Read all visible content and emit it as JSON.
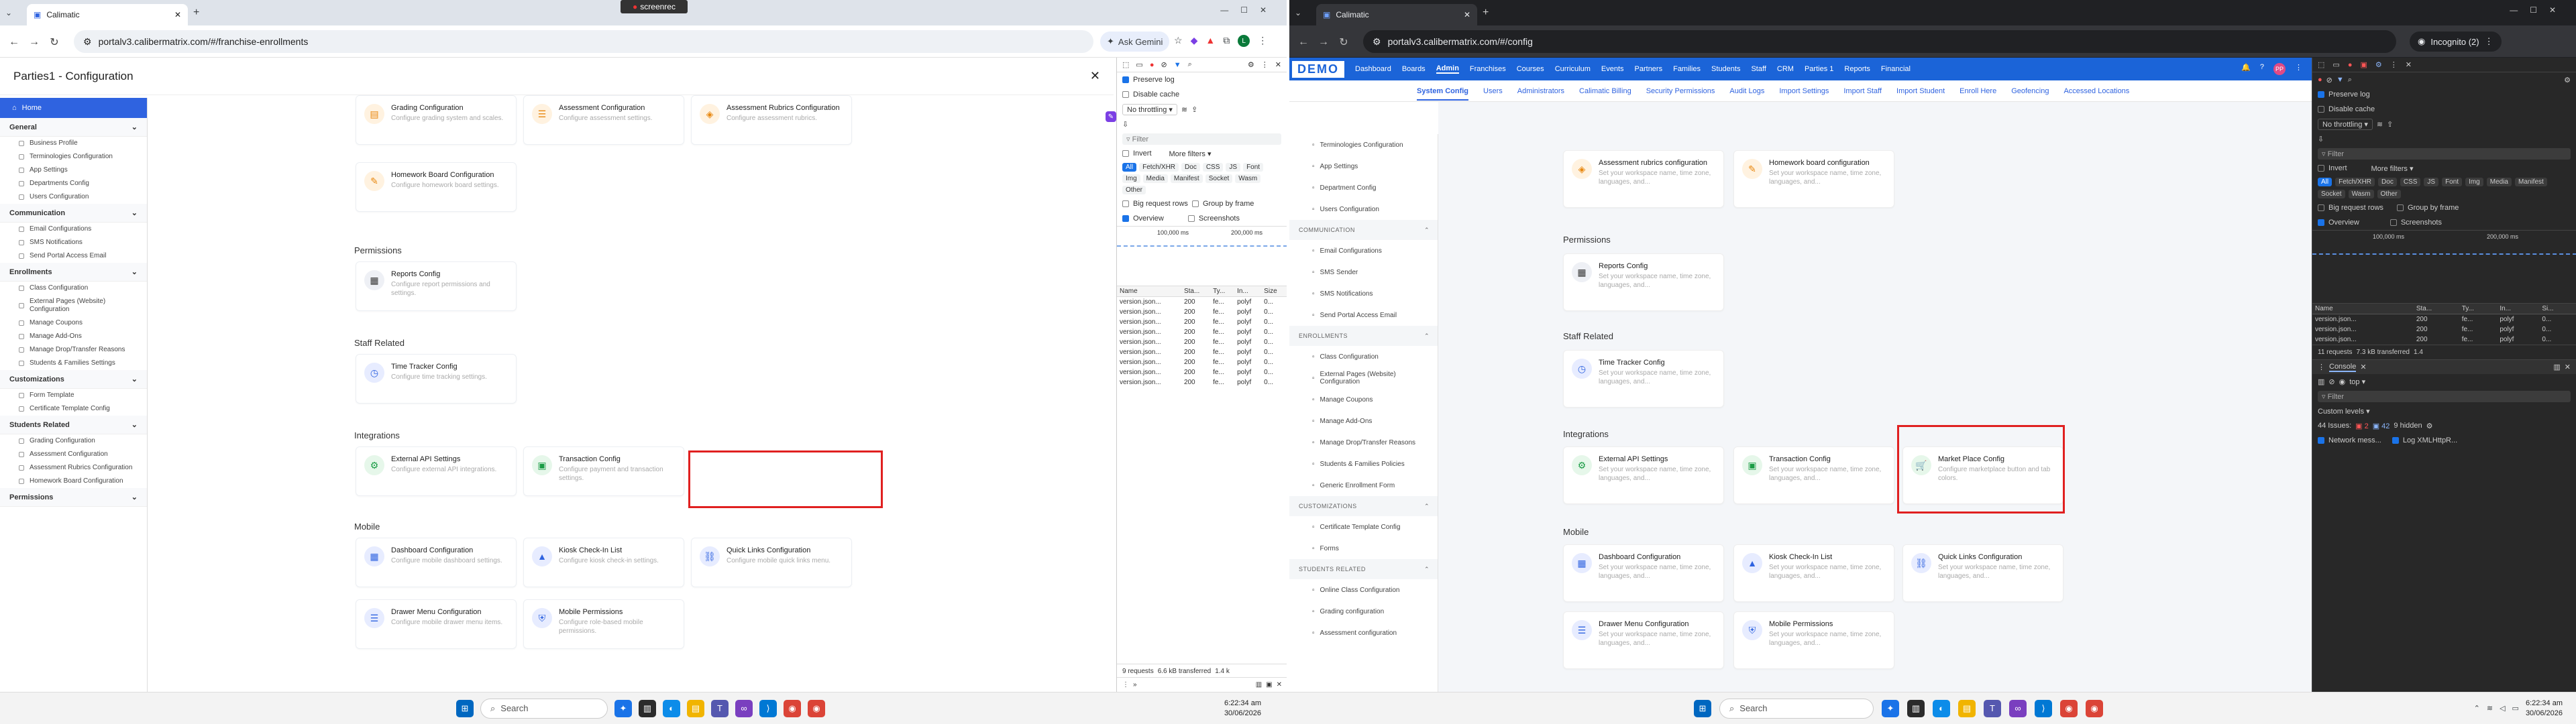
{
  "recorder": {
    "label": "screenrec"
  },
  "left": {
    "tab_title": "Calimatic",
    "url": "portalv3.calibermatrix.com/#/franchise-enrollments",
    "ask_gemini": "Ask Gemini",
    "modal_title": "Parties1 - Configuration",
    "sidebar": {
      "home": "Home",
      "sections": [
        {
          "title": "General",
          "items": [
            "Business Profile",
            "Terminologies Configuration",
            "App Settings",
            "Departments Config",
            "Users Configuration"
          ]
        },
        {
          "title": "Communication",
          "items": [
            "Email Configurations",
            "SMS Notifications",
            "Send Portal Access Email"
          ]
        },
        {
          "title": "Enrollments",
          "items": [
            "Class Configuration",
            "External Pages (Website) Configuration",
            "Manage Coupons",
            "Manage Add-Ons",
            "Manage Drop/Transfer Reasons",
            "Students & Families Settings"
          ]
        },
        {
          "title": "Customizations",
          "items": [
            "Form Template",
            "Certificate Template Config"
          ]
        },
        {
          "title": "Students Related",
          "items": [
            "Grading Configuration",
            "Assessment Configuration",
            "Assessment Rubrics Configuration",
            "Homework Board Configuration"
          ]
        },
        {
          "title": "Permissions",
          "items": []
        }
      ]
    },
    "cards_top": [
      {
        "title": "Grading Configuration",
        "desc": "Configure grading system and scales."
      },
      {
        "title": "Assessment Configuration",
        "desc": "Configure assessment settings."
      },
      {
        "title": "Assessment Rubrics Configuration",
        "desc": "Configure assessment rubrics."
      }
    ],
    "homework_card": {
      "title": "Homework Board Configuration",
      "desc": "Configure homework board settings."
    },
    "sections": {
      "permissions": "Permissions",
      "staff": "Staff Related",
      "integrations": "Integrations",
      "mobile": "Mobile"
    },
    "reports_card": {
      "title": "Reports Config",
      "desc": "Configure report permissions and settings."
    },
    "time_tracker_card": {
      "title": "Time Tracker Config",
      "desc": "Configure time tracking settings."
    },
    "integrations_cards": [
      {
        "title": "External API Settings",
        "desc": "Configure external API integrations."
      },
      {
        "title": "Transaction Config",
        "desc": "Configure payment and transaction settings."
      }
    ],
    "mobile_cards": [
      {
        "title": "Dashboard Configuration",
        "desc": "Configure mobile dashboard settings."
      },
      {
        "title": "Kiosk Check-In List",
        "desc": "Configure kiosk check-in settings."
      },
      {
        "title": "Quick Links Configuration",
        "desc": "Configure mobile quick links menu."
      },
      {
        "title": "Drawer Menu Configuration",
        "desc": "Configure mobile drawer menu items."
      },
      {
        "title": "Mobile Permissions",
        "desc": "Configure role-based mobile permissions."
      }
    ],
    "devtools": {
      "preserve_log": "Preserve log",
      "disable_cache": "Disable cache",
      "throttling": "No throttling",
      "filter": "Filter",
      "invert": "Invert",
      "more_filters": "More filters",
      "types": [
        "All",
        "Fetch/XHR",
        "Doc",
        "CSS",
        "JS",
        "Font",
        "Img",
        "Media",
        "Manifest",
        "Socket",
        "Wasm",
        "Other"
      ],
      "big_rows": "Big request rows",
      "group_frame": "Group by frame",
      "overview": "Overview",
      "screenshots": "Screenshots",
      "timeline": [
        "100,000 ms",
        "200,000 ms"
      ],
      "columns": [
        "Name",
        "Sta...",
        "Ty...",
        "In...",
        "Size"
      ],
      "rows": [
        [
          "version.json...",
          "200",
          "fe...",
          "polyf",
          "0..."
        ],
        [
          "version.json...",
          "200",
          "fe...",
          "polyf",
          "0..."
        ],
        [
          "version.json...",
          "200",
          "fe...",
          "polyf",
          "0..."
        ],
        [
          "version.json...",
          "200",
          "fe...",
          "polyf",
          "0..."
        ],
        [
          "version.json...",
          "200",
          "fe...",
          "polyf",
          "0..."
        ],
        [
          "version.json...",
          "200",
          "fe...",
          "polyf",
          "0..."
        ],
        [
          "version.json...",
          "200",
          "fe...",
          "polyf",
          "0..."
        ],
        [
          "version.json...",
          "200",
          "fe...",
          "polyf",
          "0..."
        ],
        [
          "version.json...",
          "200",
          "fe...",
          "polyf",
          "0..."
        ]
      ],
      "status": "9 requests",
      "transferred": "6.6 kB transferred",
      "size_short": "1.4 k"
    },
    "taskbar": {
      "search": "Search",
      "time": "6:22:34 am",
      "date": "30/06/2026"
    }
  },
  "right": {
    "tab_title": "Calimatic",
    "url": "portalv3.calibermatrix.com/#/config",
    "incognito": "Incognito (2)",
    "logo": "DEMO",
    "topnav": [
      "Dashboard",
      "Boards",
      "Admin",
      "Franchises",
      "Courses",
      "Curriculum",
      "Events",
      "Partners",
      "Families",
      "Students",
      "Staff",
      "CRM",
      "Parties 1",
      "Reports",
      "Financial"
    ],
    "subnav": [
      "System Config",
      "Users",
      "Administrators",
      "Calimatic Billing",
      "Security Permissions",
      "Audit Logs",
      "Import Settings",
      "Import Staff",
      "Import Student",
      "Enroll Here",
      "Geofencing",
      "Accessed Locations"
    ],
    "sidebar": {
      "general_items": [
        "Terminologies Configuration",
        "App Settings",
        "Department Config",
        "Users Configuration"
      ],
      "comm_title": "COMMUNICATION",
      "comm_items": [
        "Email Configurations",
        "SMS Sender",
        "SMS Notifications",
        "Send Portal Access Email"
      ],
      "enr_title": "ENROLLMENTS",
      "enr_items": [
        "Class Configuration",
        "External Pages (Website) Configuration",
        "Manage Coupons",
        "Manage Add-Ons",
        "Manage Drop/Transfer Reasons",
        "Students & Families Policies",
        "Generic Enrollment Form"
      ],
      "cust_title": "CUSTOMIZATIONS",
      "cust_items": [
        "Certificate Template Config",
        "Forms"
      ],
      "stu_title": "STUDENTS RELATED",
      "stu_items": [
        "Online Class Configuration",
        "Grading configuration",
        "Assessment configuration"
      ]
    },
    "desc": "Set your workspace name, time zone, languages, and...",
    "cards_top": [
      {
        "title": "Assessment rubrics configuration"
      },
      {
        "title": "Homework board configuration"
      }
    ],
    "sections": {
      "permissions": "Permissions",
      "staff": "Staff Related",
      "integrations": "Integrations",
      "mobile": "Mobile"
    },
    "reports_card": {
      "title": "Reports Config"
    },
    "time_tracker_card": {
      "title": "Time Tracker Config"
    },
    "integrations_cards": [
      {
        "title": "External API Settings"
      },
      {
        "title": "Transaction Config"
      },
      {
        "title": "Market Place Config",
        "desc": "Configure marketplace button and tab colors."
      }
    ],
    "mobile_cards": [
      {
        "title": "Dashboard Configuration"
      },
      {
        "title": "Kiosk Check-In List"
      },
      {
        "title": "Quick Links Configuration"
      },
      {
        "title": "Drawer Menu Configuration"
      },
      {
        "title": "Mobile Permissions"
      }
    ],
    "devtools": {
      "preserve_log": "Preserve log",
      "disable_cache": "Disable cache",
      "throttling": "No throttling",
      "filter": "Filter",
      "invert": "Invert",
      "more_filters": "More filters",
      "types": [
        "All",
        "Fetch/XHR",
        "Doc",
        "CSS",
        "JS",
        "Font",
        "Img",
        "Media",
        "Manifest",
        "Socket",
        "Wasm",
        "Other"
      ],
      "big_rows": "Big request rows",
      "group_frame": "Group by frame",
      "overview": "Overview",
      "screenshots": "Screenshots",
      "timeline": [
        "100,000 ms",
        "200,000 ms"
      ],
      "columns": [
        "Name",
        "Sta...",
        "Ty...",
        "In...",
        "Si..."
      ],
      "rows": [
        [
          "version.json...",
          "200",
          "fe...",
          "polyf",
          "0..."
        ],
        [
          "version.json...",
          "200",
          "fe...",
          "polyf",
          "0..."
        ],
        [
          "version.json...",
          "200",
          "fe...",
          "polyf",
          "0..."
        ]
      ],
      "status": "11 requests",
      "transferred": "7.3 kB transferred",
      "size_short": "1.4",
      "console_tab": "Console",
      "context": "top",
      "console_filter": "Filter",
      "levels": "Custom levels",
      "issues": "44 Issues:",
      "issues_red": "2",
      "issues_blue": "42",
      "hidden": "9 hidden",
      "net_msg": "Network mess...",
      "log_xhr": "Log XMLHttpR..."
    },
    "taskbar": {
      "search": "Search",
      "time": "6:22:34 am",
      "date": "30/06/2026"
    }
  },
  "colors": {
    "accent": "#2f63e0",
    "highlight": "#e02020",
    "devtools_dark": "#282828"
  }
}
